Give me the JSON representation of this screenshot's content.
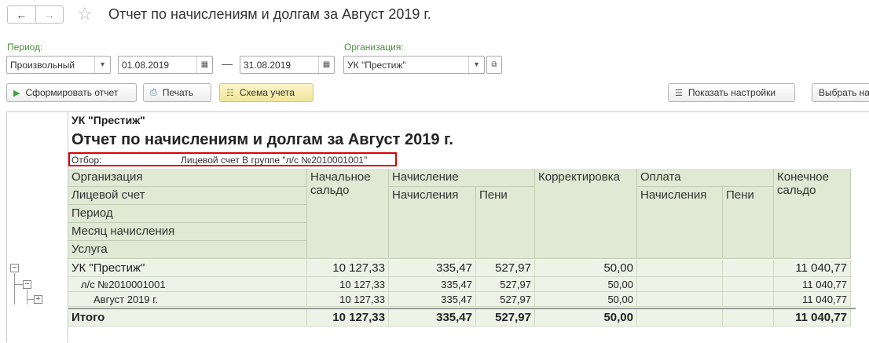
{
  "window": {
    "title": "Отчет по начислениям и долгам за Август 2019 г.",
    "back_icon": "arrow-left-icon",
    "forward_icon": "arrow-right-icon",
    "favorite_icon": "star-icon"
  },
  "filters": {
    "period_label": "Период:",
    "period_type": "Произвольный",
    "date_from": "01.08.2019",
    "dash": "—",
    "date_to": "31.08.2019",
    "org_label": "Организация:",
    "org_value": "УК \"Престиж\""
  },
  "toolbar": {
    "generate": "Сформировать отчет",
    "print": "Печать",
    "scheme": "Схема учета",
    "show_settings": "Показать настройки",
    "choose": "Выбрать на"
  },
  "report": {
    "org": "УК \"Престиж\"",
    "title": "Отчет по начислениям и долгам за Август 2019 г.",
    "filter_key": "Отбор:",
    "filter_value": "Лицевой счет В группе \"л/с №2010001001\"",
    "headers": {
      "organization": "Организация",
      "account": "Лицевой счет",
      "period": "Период",
      "month": "Месяц начисления",
      "service": "Услуга",
      "opening": "Начальное сальдо",
      "accrual": "Начисление",
      "accrual_accruals": "Начисления",
      "accrual_penalty": "Пени",
      "correction": "Корректировка",
      "payment": "Оплата",
      "payment_accruals": "Начисления",
      "payment_penalty": "Пени",
      "closing": "Конечное сальдо"
    },
    "rows": [
      {
        "name": "УК \"Престиж\"",
        "opening": "10 127,33",
        "accrual": "335,47",
        "penalty": "527,97",
        "correction": "50,00",
        "pay_acc": "",
        "pay_pen": "",
        "closing": "11 040,77"
      },
      {
        "name": "л/с №2010001001",
        "opening": "10 127,33",
        "accrual": "335,47",
        "penalty": "527,97",
        "correction": "50,00",
        "pay_acc": "",
        "pay_pen": "",
        "closing": "11 040,77"
      },
      {
        "name": "Август 2019  г.",
        "opening": "10 127,33",
        "accrual": "335,47",
        "penalty": "527,97",
        "correction": "50,00",
        "pay_acc": "",
        "pay_pen": "",
        "closing": "11 040,77"
      }
    ],
    "total": {
      "name": "Итого",
      "opening": "10 127,33",
      "accrual": "335,47",
      "penalty": "527,97",
      "correction": "50,00",
      "pay_acc": "",
      "pay_pen": "",
      "closing": "11 040,77"
    }
  }
}
